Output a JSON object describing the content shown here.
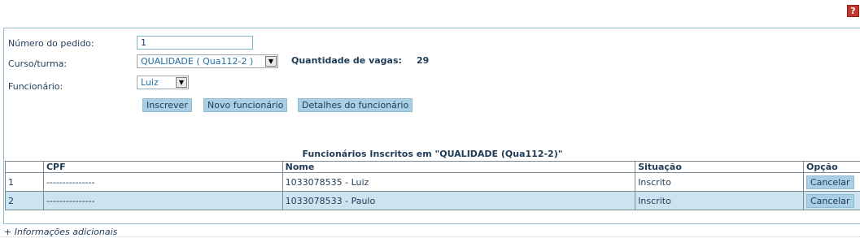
{
  "help": {
    "label": "?"
  },
  "form": {
    "pedido_label": "Número do pedido:",
    "pedido_value": "1",
    "curso_label": "Curso/turma:",
    "curso_value": "QUALIDADE ( Qua112-2 )",
    "vagas_label": "Quantidade de vagas:",
    "vagas_value": "29",
    "funcionario_label": "Funcionário:",
    "funcionario_value": "Luiz"
  },
  "buttons": {
    "inscrever": "Inscrever",
    "novo": "Novo funcionário",
    "detalhes": "Detalhes do funcionário"
  },
  "table": {
    "title": "Funcionários Inscritos em   \"QUALIDADE (Qua112-2)\"",
    "headers": [
      "",
      "CPF",
      "Nome",
      "Situação",
      "Opção"
    ],
    "rows": [
      {
        "num": "1",
        "cpf": "---------------",
        "nome": "1033078535 - Luiz",
        "situacao": "Inscrito",
        "opcao": "Cancelar"
      },
      {
        "num": "2",
        "cpf": "---------------",
        "nome": "1033078533 - Paulo",
        "situacao": "Inscrito",
        "opcao": "Cancelar"
      }
    ]
  },
  "footer": {
    "info_link": "+ Informações adicionais"
  },
  "colors": {
    "accent": "#a9cfe3",
    "panel_border": "#8dbdcf",
    "row_alt": "#cde3ef",
    "help_red": "#c0392b"
  }
}
